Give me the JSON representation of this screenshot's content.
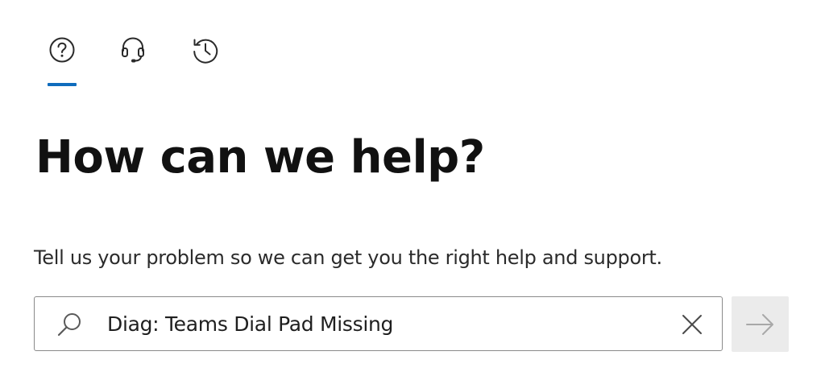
{
  "tabs": [
    {
      "icon": "help-circle-icon"
    },
    {
      "icon": "headset-icon"
    },
    {
      "icon": "history-icon"
    }
  ],
  "main": {
    "title": "How can we help?",
    "subtitle": "Tell us your problem so we can get you the right help and support."
  },
  "search": {
    "value": "Diag: Teams Dial Pad Missing",
    "placeholder": ""
  },
  "colors": {
    "accent": "#0f6cbd",
    "submit_bg": "#ebebeb",
    "border": "#8a8a8a"
  }
}
